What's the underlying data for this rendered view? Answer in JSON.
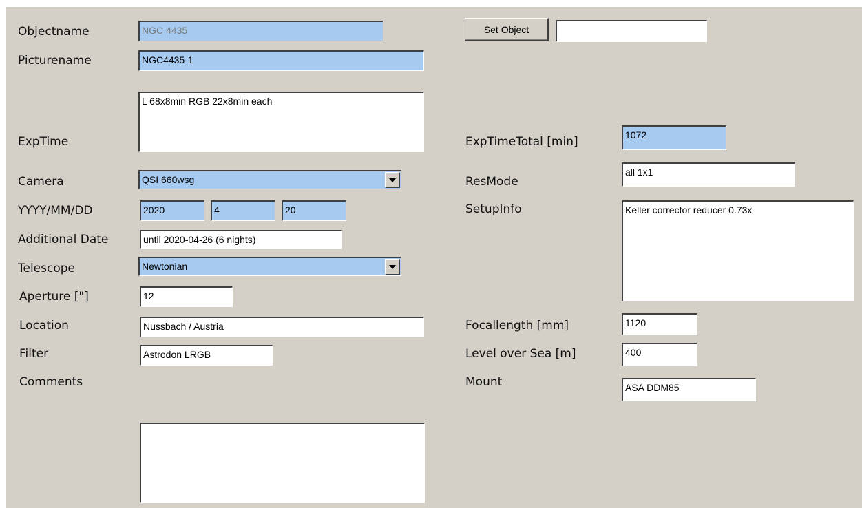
{
  "labels": {
    "objectname": "Objectname",
    "picturename": "Picturename",
    "exptime": "ExpTime",
    "camera": "Camera",
    "date": "YYYY/MM/DD",
    "additional_date": "Additional Date",
    "telescope": "Telescope",
    "aperture": "Aperture [\"]",
    "location": "Location",
    "filter": "Filter",
    "comments": "Comments",
    "exptime_total": "ExpTimeTotal [min]",
    "resmode": "ResMode",
    "setupinfo": "SetupInfo",
    "focallength": "Focallength [mm]",
    "level_over_sea": "Level over Sea [m]",
    "mount": "Mount"
  },
  "fields": {
    "objectname": "NGC 4435",
    "picturename": "NGC4435-1",
    "exptime": "L 68x8min RGB 22x8min each",
    "camera": "QSI 660wsg",
    "year": "2020",
    "month": "4",
    "day": "20",
    "additional_date": "until 2020-04-26 (6 nights)",
    "telescope": "Newtonian",
    "aperture": "12",
    "location": "Nussbach / Austria",
    "filter": "Astrodon LRGB",
    "comments": "",
    "set_object_input": "",
    "exptime_total": "1072",
    "resmode": "all 1x1",
    "setupinfo": "Keller corrector reducer 0.73x",
    "focallength": "1120",
    "level_over_sea": "400",
    "mount": "ASA DDM85"
  },
  "buttons": {
    "set_object": "Set Object"
  },
  "colors": {
    "panel_bg": "#d4d0c8",
    "field_highlight": "#a6caf0",
    "field_bg": "#ffffff"
  },
  "icons": {
    "dropdown": "chevron-down-icon"
  }
}
